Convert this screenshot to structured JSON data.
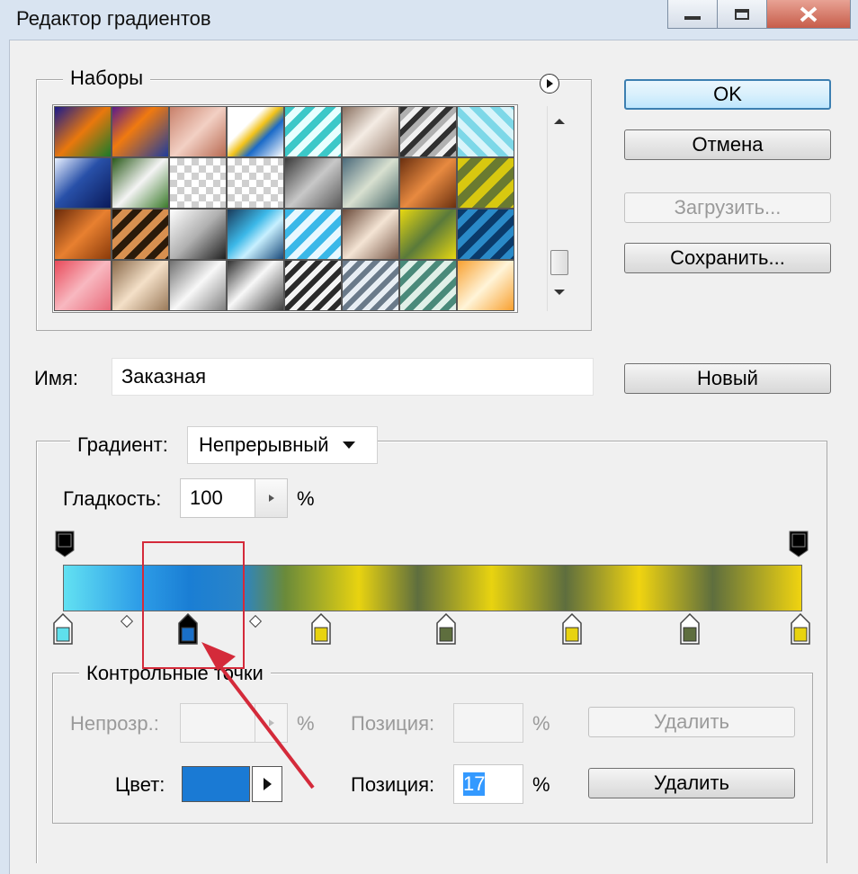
{
  "window": {
    "title": "Редактор градиентов"
  },
  "presets": {
    "legend": "Наборы",
    "swatches": [
      "linear-gradient(135deg,#1a1a8c 0%,#e9780d 50%,#1a7a2a 100%)",
      "linear-gradient(135deg,#5a1a8c 0%,#f07a10 40%,#1e3c9c 100%)",
      "linear-gradient(135deg,#c8806a 0%,#f2d0c4 50%,#b86a52 100%)",
      "linear-gradient(135deg,#fff 0%,#fff 35%,#f2c21a 50%,#1a6ac8 65%,#fff 100%)",
      "repeating-linear-gradient(135deg,#3cc8c8 0 8px,#e8ffff 8px 16px)",
      "linear-gradient(135deg,#8a7060 0%,#f4ece4 45%,#9a8070 100%)",
      "repeating-linear-gradient(135deg,#303030 0 6px,#b0b0b0 6px 12px,#f0f0f0 12px 18px)",
      "repeating-linear-gradient(45deg,#7dd8e8 0 8px,#d8f4fa 8px 16px)",
      "linear-gradient(135deg,#e8f0ff 0%,#2850a8 45%,#0a1a5a 100%)",
      "linear-gradient(135deg,#2a5a1a 0%,#f4f4f4 50%,#3a7a2a 100%)",
      "repeating-conic-gradient(#cfcfcf 0 25%,#fff 0 50%) 0 0/16px 16px",
      "repeating-conic-gradient(#cfcfcf 0 25%,#fff 0 50%) 0 0/16px 16px",
      "linear-gradient(135deg,#3a3a3a 0%,#c8c8c8 50%,#5a5a5a 100%)",
      "linear-gradient(135deg,#4a6a7a 0%,#d8e0d0 50%,#4a6a6a 100%)",
      "linear-gradient(135deg,#6a3010 0%,#e88a40 50%,#6a3010 100%)",
      "repeating-linear-gradient(135deg,#d8c810 0 10px,#6a7a30 10px 20px)",
      "linear-gradient(135deg,#6a2a0a 0%,#e88030 50%,#8a3a0a 100%)",
      "repeating-linear-gradient(135deg,#2a1a0a 0 8px,#d89050 8px 16px)",
      "linear-gradient(135deg,#fff 0%,#b0b0b0 50%,#202020 100%)",
      "linear-gradient(135deg,#1a3a5a 0%,#3cb8e8 40%,#c8f0ff 60%,#1a4a7a 100%)",
      "repeating-linear-gradient(135deg,#3ab8e8 0 8px,#e8f8ff 8px 16px)",
      "linear-gradient(135deg,#6a4a3a 0%,#f4e4d4 50%,#7a5a4a 100%)",
      "linear-gradient(135deg,#e8d810 0%,#5a7a3a 50%,#e8d810 100%)",
      "repeating-linear-gradient(135deg,#0a3a6a 0 8px,#2a8ac8 8px 16px)",
      "linear-gradient(135deg,#e84a5a 0%,#f8b8c0 50%,#e86a7a 100%)",
      "linear-gradient(135deg,#8a6a4a 0%,#f4e0c8 50%,#9a7a5a 100%)",
      "linear-gradient(135deg,#707070 0%,#f8f8f8 50%,#808080 100%)",
      "linear-gradient(135deg,#303030 0%,#f8f8f8 45%,#404040 100%)",
      "repeating-linear-gradient(135deg,#2a2a2a 0 6px,#f4f4f4 6px 12px)",
      "repeating-linear-gradient(135deg,#6a7a8a 0 6px,#e8eef4 6px 12px)",
      "repeating-linear-gradient(135deg,#4a8a7a 0 7px,#e0f0e8 7px 14px)",
      "linear-gradient(135deg,#f8a030 0%,#fff4d8 50%,#f8a030 100%)"
    ]
  },
  "buttons": {
    "ok": "OK",
    "cancel": "Отмена",
    "load": "Загрузить...",
    "save": "Сохранить...",
    "new": "Новый"
  },
  "name": {
    "label": "Имя:",
    "value": "Заказная"
  },
  "gradient": {
    "type_label": "Градиент:",
    "type_value": "Непрерывный",
    "smoothness_label": "Гладкость:",
    "smoothness_value": "100",
    "smoothness_unit": "%",
    "bar": "linear-gradient(90deg,#62e1f2 0%,#2e9ee8 10%,#1a7ed4 17%,#2a84c8 24%,#6a8a3a 30%,#e8d310 40%,#5e6e3e 48%,#e8d310 58%,#5e6e3e 68%,#f0d410 78%,#5e6e3e 88%,#f0d410 100%)",
    "color_stops": [
      {
        "position": 0,
        "color": "#5fe0ec"
      },
      {
        "position": 17,
        "color": "#1a6fc8"
      },
      {
        "position": 35,
        "color": "#e8d310"
      },
      {
        "position": 52,
        "color": "#5e6e3e"
      },
      {
        "position": 69,
        "color": "#e8d310"
      },
      {
        "position": 85,
        "color": "#5e6e3e"
      },
      {
        "position": 100,
        "color": "#e8d310"
      }
    ],
    "selected_stop": 1
  },
  "stops": {
    "legend": "Контрольные точки",
    "opacity_label": "Непрозр.:",
    "opacity_unit": "%",
    "opacity_position_label": "Позиция:",
    "opacity_position_unit": "%",
    "opacity_delete": "Удалить",
    "color_label": "Цвет:",
    "color_value": "#1a7ad4",
    "color_position_label": "Позиция:",
    "color_position_value": "17",
    "color_position_unit": "%",
    "color_delete": "Удалить"
  },
  "annotation": {
    "color": "#d42a3a"
  }
}
